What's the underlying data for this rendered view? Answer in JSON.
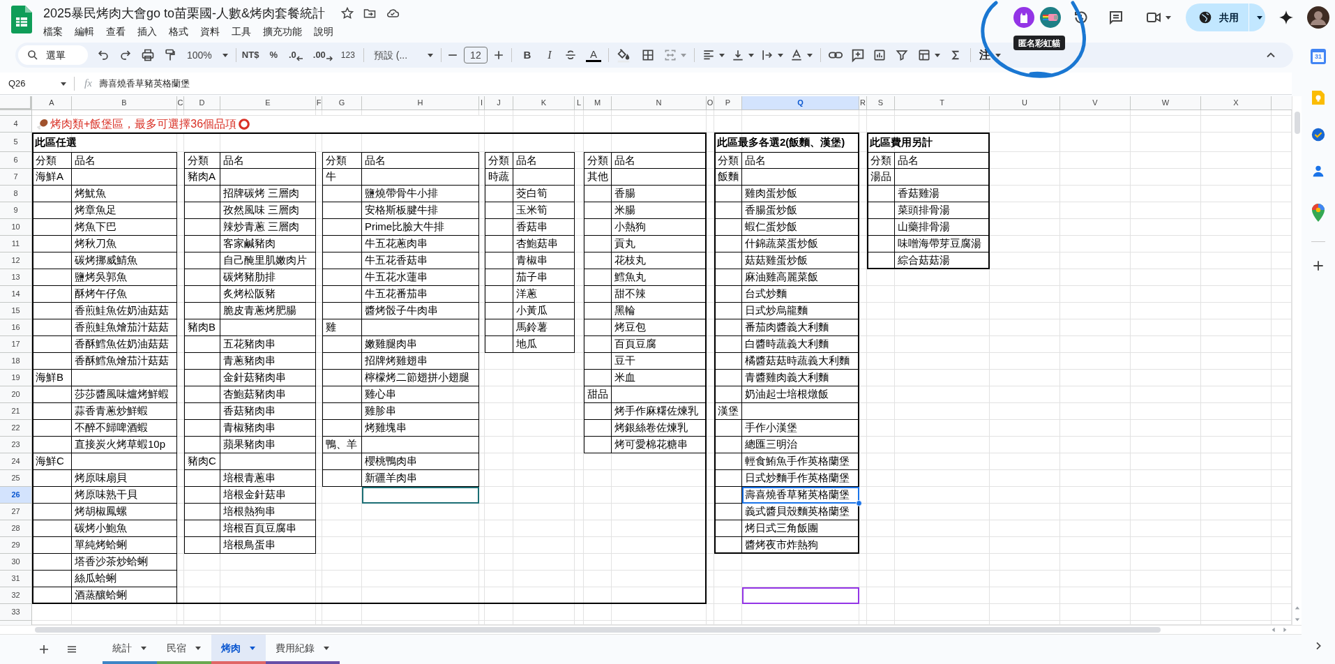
{
  "app": {
    "title": "2025暴民烤肉大會go to苗栗國-人數&烤肉套餐統計",
    "menus": [
      "檔案",
      "編輯",
      "查看",
      "插入",
      "格式",
      "資料",
      "工具",
      "擴充功能",
      "說明"
    ]
  },
  "collaboration": {
    "tooltip": "匿名彩虹貓",
    "share": "共用"
  },
  "toolbar": {
    "search": "選單",
    "zoom": "100%",
    "currency": "NT$",
    "percent": "%",
    "decimals_down": ".0",
    "decimals_up": ".00",
    "number_format": "123",
    "font": "預設 (...",
    "font_size": "12",
    "bold": "B",
    "italic": "I",
    "text_color": "A",
    "input_tools": "注"
  },
  "formula_bar": {
    "cell": "Q26",
    "fx": "fx",
    "content": "壽喜燒香草豬英格蘭堡"
  },
  "side_panel": {
    "calendar_day": "31"
  },
  "sheet": {
    "columns": [
      {
        "label": "A",
        "selected": false
      },
      {
        "label": "B",
        "selected": false
      },
      {
        "label": "C",
        "selected": false
      },
      {
        "label": "D",
        "selected": false
      },
      {
        "label": "E",
        "selected": false
      },
      {
        "label": "F",
        "selected": false
      },
      {
        "label": "G",
        "selected": false
      },
      {
        "label": "H",
        "selected": false,
        "color": "#1b6e74"
      },
      {
        "label": "I",
        "selected": false
      },
      {
        "label": "J",
        "selected": false
      },
      {
        "label": "K",
        "selected": false
      },
      {
        "label": "L",
        "selected": false
      },
      {
        "label": "M",
        "selected": false
      },
      {
        "label": "N",
        "selected": false
      },
      {
        "label": "O",
        "selected": false
      },
      {
        "label": "P",
        "selected": false
      },
      {
        "label": "Q",
        "selected": true,
        "color": "#9334e6"
      },
      {
        "label": "R",
        "selected": false
      },
      {
        "label": "S",
        "selected": false
      },
      {
        "label": "T",
        "selected": false
      },
      {
        "label": "U",
        "selected": false
      },
      {
        "label": "V",
        "selected": false
      },
      {
        "label": "W",
        "selected": false
      },
      {
        "label": "X",
        "selected": false
      }
    ],
    "rows": [
      {
        "label": "4",
        "selected": false
      },
      {
        "label": "5",
        "selected": false
      },
      {
        "label": "6",
        "selected": false
      },
      {
        "label": "7",
        "selected": false
      },
      {
        "label": "8",
        "selected": false
      },
      {
        "label": "9",
        "selected": false
      },
      {
        "label": "10",
        "selected": false
      },
      {
        "label": "11",
        "selected": false
      },
      {
        "label": "12",
        "selected": false
      },
      {
        "label": "13",
        "selected": false
      },
      {
        "label": "14",
        "selected": false
      },
      {
        "label": "15",
        "selected": false
      },
      {
        "label": "16",
        "selected": false
      },
      {
        "label": "17",
        "selected": false
      },
      {
        "label": "18",
        "selected": false
      },
      {
        "label": "19",
        "selected": false
      },
      {
        "label": "20",
        "selected": false
      },
      {
        "label": "21",
        "selected": false
      },
      {
        "label": "22",
        "selected": false
      },
      {
        "label": "23",
        "selected": false
      },
      {
        "label": "24",
        "selected": false
      },
      {
        "label": "25",
        "selected": false
      },
      {
        "label": "26",
        "selected": true,
        "color": "#1b6e74"
      },
      {
        "label": "27",
        "selected": false
      },
      {
        "label": "28",
        "selected": false
      },
      {
        "label": "29",
        "selected": false
      },
      {
        "label": "30",
        "selected": false
      },
      {
        "label": "31",
        "selected": false
      },
      {
        "label": "32",
        "selected": false,
        "color": "#9334e6"
      },
      {
        "label": "33",
        "selected": false
      }
    ],
    "notice": "烤肉類+飯堡區，最多可選擇36個品項",
    "sections": [
      {
        "title": "此區任選",
        "lists": [
          {
            "header": [
              "分類",
              "品名"
            ],
            "groups": [
              {
                "category": "海鮮A",
                "items": [
                  "烤魷魚",
                  "烤章魚足",
                  "烤魚下巴",
                  "烤秋刀魚",
                  "碳烤挪威鯖魚",
                  "鹽烤吳郭魚",
                  "酥烤午仔魚",
                  "香煎鮭魚佐奶油菇菇",
                  "香煎鮭魚燴茄汁菇菇",
                  "香酥鱈魚佐奶油菇菇",
                  "香酥鱈魚燴茄汁菇菇"
                ]
              },
              {
                "category": "海鮮B",
                "items": [
                  "莎莎醬風味爐烤鮮蝦",
                  "蒜香青蔥炒鮮蝦",
                  "不醉不歸啤酒蝦",
                  "直接炭火烤草蝦10p"
                ]
              },
              {
                "category": "海鮮C",
                "items": [
                  "烤原味扇貝",
                  "烤原味熟干貝",
                  "烤胡椒鳳螺",
                  "碳烤小鮑魚",
                  "單純烤蛤蜊",
                  "塔香沙茶炒蛤蜊",
                  "絲瓜蛤蜊",
                  "酒蒸釀蛤蜊"
                ]
              }
            ]
          },
          {
            "header": [
              "分類",
              "品名"
            ],
            "groups": [
              {
                "category": "豬肉A",
                "items": [
                  "招牌碳烤 三層肉",
                  "孜然風味 三層肉",
                  "辣炒青蔥 三層肉",
                  "客家鹹豬肉",
                  "自己醃里肌嫩肉片",
                  "碳烤豬肋排",
                  "炙烤松阪豬",
                  "脆皮青蔥烤肥腸"
                ]
              },
              {
                "category": "豬肉B",
                "items": [
                  "五花豬肉串",
                  "青蔥豬肉串",
                  "金針菇豬肉串",
                  "杏鮑菇豬肉串",
                  "香菇豬肉串",
                  "青椒豬肉串",
                  "蘋果豬肉串"
                ]
              },
              {
                "category": "豬肉C",
                "items": [
                  "培根青蔥串",
                  "培根金針菇串",
                  "培根熱狗串",
                  "培根百頁豆腐串",
                  "培根鳥蛋串"
                ]
              }
            ]
          },
          {
            "header": [
              "分類",
              "品名"
            ],
            "groups": [
              {
                "category": "牛",
                "items": [
                  "鹽燒帶骨牛小排",
                  "安格斯板腱牛排",
                  "Prime比臉大牛排",
                  "牛五花蔥肉串",
                  "牛五花香菇串",
                  "牛五花水蓮串",
                  "牛五花番茄串",
                  "醬烤骰子牛肉串"
                ]
              },
              {
                "category": "雞",
                "items": [
                  "嫩雞腿肉串",
                  "招牌烤雞翅串",
                  "檸檬烤二節翅拼小翅腿",
                  "雞心串",
                  "雞胗串",
                  "烤雞塊串"
                ]
              },
              {
                "category": "鴨、羊",
                "items": [
                  "櫻桃鴨肉串",
                  "新疆羊肉串"
                ]
              }
            ]
          },
          {
            "header": [
              "分類",
              "品名"
            ],
            "groups": [
              {
                "category": "時蔬",
                "items": [
                  "茭白筍",
                  "玉米筍",
                  "香菇串",
                  "杏鮑菇串",
                  "青椒串",
                  "茄子串",
                  "洋蔥",
                  "小黃瓜",
                  "馬鈴薯",
                  "地瓜"
                ]
              }
            ]
          },
          {
            "header": [
              "分類",
              "品名"
            ],
            "groups": [
              {
                "category": "其他",
                "items": [
                  "香腸",
                  "米腸",
                  "小熱狗",
                  "貢丸",
                  "花枝丸",
                  "鱈魚丸",
                  "甜不辣",
                  "黑輪",
                  "烤豆包",
                  "百頁豆腐",
                  "豆干",
                  "米血"
                ]
              },
              {
                "category": "甜品",
                "items": [
                  "烤手作麻糬佐煉乳",
                  "烤銀絲卷佐煉乳",
                  "烤可愛棉花糖串"
                ]
              }
            ]
          }
        ]
      },
      {
        "title": "此區最多各選2(飯麵、漢堡)",
        "lists": [
          {
            "header": [
              "分類",
              "品名"
            ],
            "groups": [
              {
                "category": "飯麵",
                "items": [
                  "雞肉蛋炒飯",
                  "香腸蛋炒飯",
                  "蝦仁蛋炒飯",
                  "什錦蔬菜蛋炒飯",
                  "菇菇雞蛋炒飯",
                  "麻油雞高麗菜飯",
                  "台式炒麵",
                  "日式炒烏龍麵",
                  "番茄肉醬義大利麵",
                  "白醬時蔬義大利麵",
                  "橘醬菇菇時蔬義大利麵",
                  "青醬雞肉義大利麵",
                  "奶油起士培根燉飯"
                ]
              },
              {
                "category": "漢堡",
                "items": [
                  "手作小漢堡",
                  "總匯三明治",
                  "輕食鮪魚手作英格蘭堡",
                  "日式炒麵手作英格蘭堡",
                  "壽喜燒香草豬英格蘭堡",
                  "義式醬貝殼麵英格蘭堡",
                  "烤日式三角飯團",
                  "醬烤夜市炸熱狗"
                ]
              }
            ]
          }
        ]
      },
      {
        "title": "此區費用另計",
        "lists": [
          {
            "header": [
              "分類",
              "品名"
            ],
            "groups": [
              {
                "category": "湯品",
                "items": [
                  "香菇雞湯",
                  "菜頭排骨湯",
                  "山藥排骨湯",
                  "味噌海帶芽豆腐湯",
                  "綜合菇菇湯"
                ]
              }
            ]
          }
        ]
      }
    ]
  },
  "sheet_tabs": [
    {
      "label": "統計",
      "color": "#3d85c6",
      "selected": false
    },
    {
      "label": "民宿",
      "color": "#6aa84f",
      "selected": false
    },
    {
      "label": "烤肉",
      "color": "#e06666",
      "selected": true
    },
    {
      "label": "費用紀錄",
      "color": "#674ea7",
      "selected": false
    }
  ]
}
